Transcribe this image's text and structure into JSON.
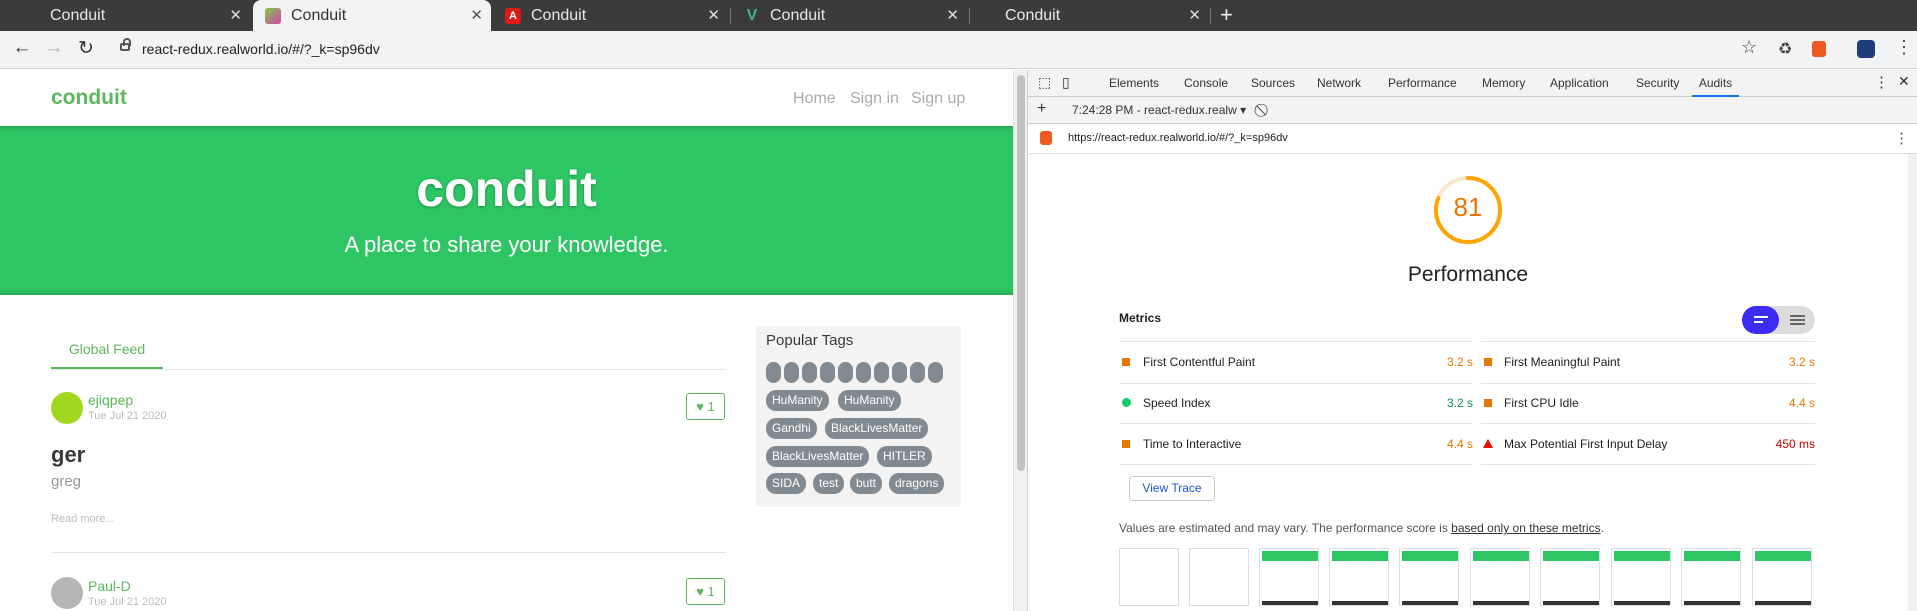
{
  "browser": {
    "tabs": [
      {
        "title": "Conduit"
      },
      {
        "title": "Conduit"
      },
      {
        "title": "Conduit"
      },
      {
        "title": "Conduit"
      },
      {
        "title": "Conduit"
      }
    ],
    "new_tab": "+",
    "url": "react-redux.realworld.io/#/?_k=sp96dv",
    "colors": {
      "active_tab_bg": "#f1f3f4",
      "tabstrip_bg": "#3b3b3b"
    }
  },
  "site": {
    "brand": "conduit",
    "nav": [
      "Home",
      "Sign in",
      "Sign up"
    ],
    "banner_title": "conduit",
    "banner_subtitle": "A place to share your knowledge.",
    "feed_tab": "Global Feed",
    "articles": [
      {
        "author": "ejiqpep",
        "date": "Tue Jul 21 2020",
        "likes": "1",
        "title": "ger",
        "description": "greg",
        "read_more": "Read more..."
      },
      {
        "author": "Paul-D",
        "date": "Tue Jul 21 2020",
        "likes": "1"
      }
    ],
    "popular_tags_title": "Popular Tags",
    "tags": [
      "HuManity",
      "HuManity",
      "Gandhi",
      "BlackLivesMatter",
      "BlackLivesMatter",
      "HITLER",
      "SIDA",
      "test",
      "butt",
      "dragons"
    ],
    "accent_color": "#5cb85c"
  },
  "devtools": {
    "tabs": [
      "Elements",
      "Console",
      "Sources",
      "Network",
      "Performance",
      "Memory",
      "Application",
      "Security",
      "Audits"
    ],
    "active_tab": "Audits",
    "report_selector": "7:24:28 PM - react-redux.realw",
    "audit_url": "https://react-redux.realworld.io/#/?_k=sp96dv",
    "score": "81",
    "score_fraction": 0.81,
    "category": "Performance",
    "metrics_title": "Metrics",
    "metrics_left": [
      {
        "name": "First Contentful Paint",
        "value": "3.2 s",
        "status": "average"
      },
      {
        "name": "Speed Index",
        "value": "3.2 s",
        "status": "pass"
      },
      {
        "name": "Time to Interactive",
        "value": "4.4 s",
        "status": "average"
      }
    ],
    "metrics_right": [
      {
        "name": "First Meaningful Paint",
        "value": "3.2 s",
        "status": "average"
      },
      {
        "name": "First CPU Idle",
        "value": "4.4 s",
        "status": "average"
      },
      {
        "name": "Max Potential First Input Delay",
        "value": "450 ms",
        "status": "fail"
      }
    ],
    "view_trace": "View Trace",
    "note_prefix": "Values are estimated and may vary. The performance score is ",
    "note_link": "based only on these metrics",
    "note_suffix": ".",
    "colors": {
      "average": "#e67700",
      "pass": "#0cce6b",
      "fail": "#eb0f00",
      "toggle_on": "#3d2bf5"
    }
  }
}
